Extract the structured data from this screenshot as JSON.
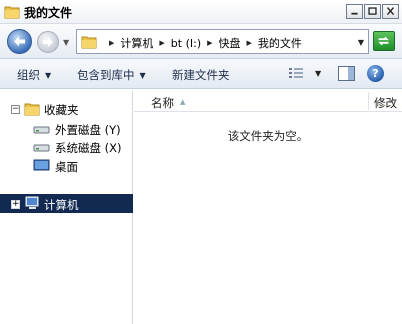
{
  "window": {
    "title": "我的文件"
  },
  "address": {
    "crumbs": [
      "计算机",
      "bt (I:)",
      "快盘",
      "我的文件"
    ]
  },
  "toolbar": {
    "organize": "组织",
    "include_in_library": "包含到库中",
    "new_folder": "新建文件夹",
    "help_glyph": "?"
  },
  "nav": {
    "favorites": "收藏夹",
    "items": [
      "外置磁盘 (Y)",
      "系统磁盘 (X)",
      "桌面"
    ],
    "computer": "计算机",
    "expand_glyph": "+",
    "collapse_glyph": "−"
  },
  "files": {
    "columns": {
      "name": "名称",
      "modified": "修改"
    },
    "empty_message": "该文件夹为空。"
  },
  "colors": {
    "selection": "#122a52",
    "accent": "#3a6fb8"
  }
}
